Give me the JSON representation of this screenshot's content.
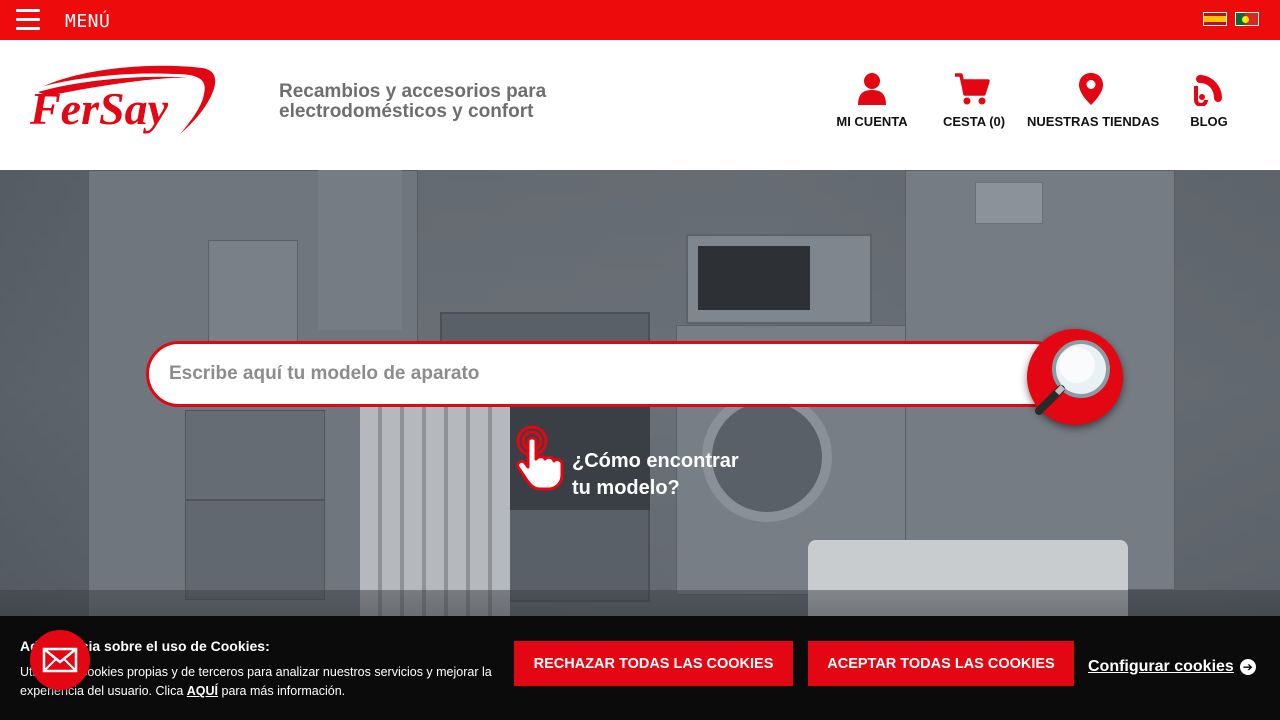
{
  "topbar": {
    "menu_label": "MENÚ",
    "languages": [
      {
        "icon": "spain-flag-icon",
        "code": "es"
      },
      {
        "icon": "portugal-flag-icon",
        "code": "pt"
      }
    ]
  },
  "header": {
    "logo_text": "FerSay",
    "tagline_line1": "Recambios y accesorios para",
    "tagline_line2": "electrodomésticos y confort",
    "nav": [
      {
        "label": "MI CUENTA",
        "icon": "user-icon"
      },
      {
        "label": "CESTA (0)",
        "icon": "cart-icon"
      },
      {
        "label": "NUESTRAS TIENDAS",
        "icon": "location-pin-icon"
      },
      {
        "label": "BLOG",
        "icon": "rss-icon"
      }
    ]
  },
  "hero": {
    "search_placeholder": "Escribe aquí tu modelo de aparato",
    "search_value": "",
    "how_line1": "¿Cómo encontrar",
    "how_line2": "tu modelo?"
  },
  "cookies": {
    "title": "Advertencia sobre el uso de Cookies:",
    "text_before": "Utilizamos cookies propias y de terceros para analizar nuestros servicios y mejorar la experiencia del usuario. Clica ",
    "link_text": "AQUÍ",
    "text_after": " para más información.",
    "reject_label": "RECHAZAR TODAS LAS COOKIES",
    "accept_label": "ACEPTAR TODAS LAS COOKIES",
    "config_label": "Configurar cookies"
  },
  "colors": {
    "brand_red": "#e30613",
    "topbar_red": "#ee0b0b",
    "cookie_bg": "#0b0b0b",
    "tagline_grey": "#6e6e6e"
  }
}
